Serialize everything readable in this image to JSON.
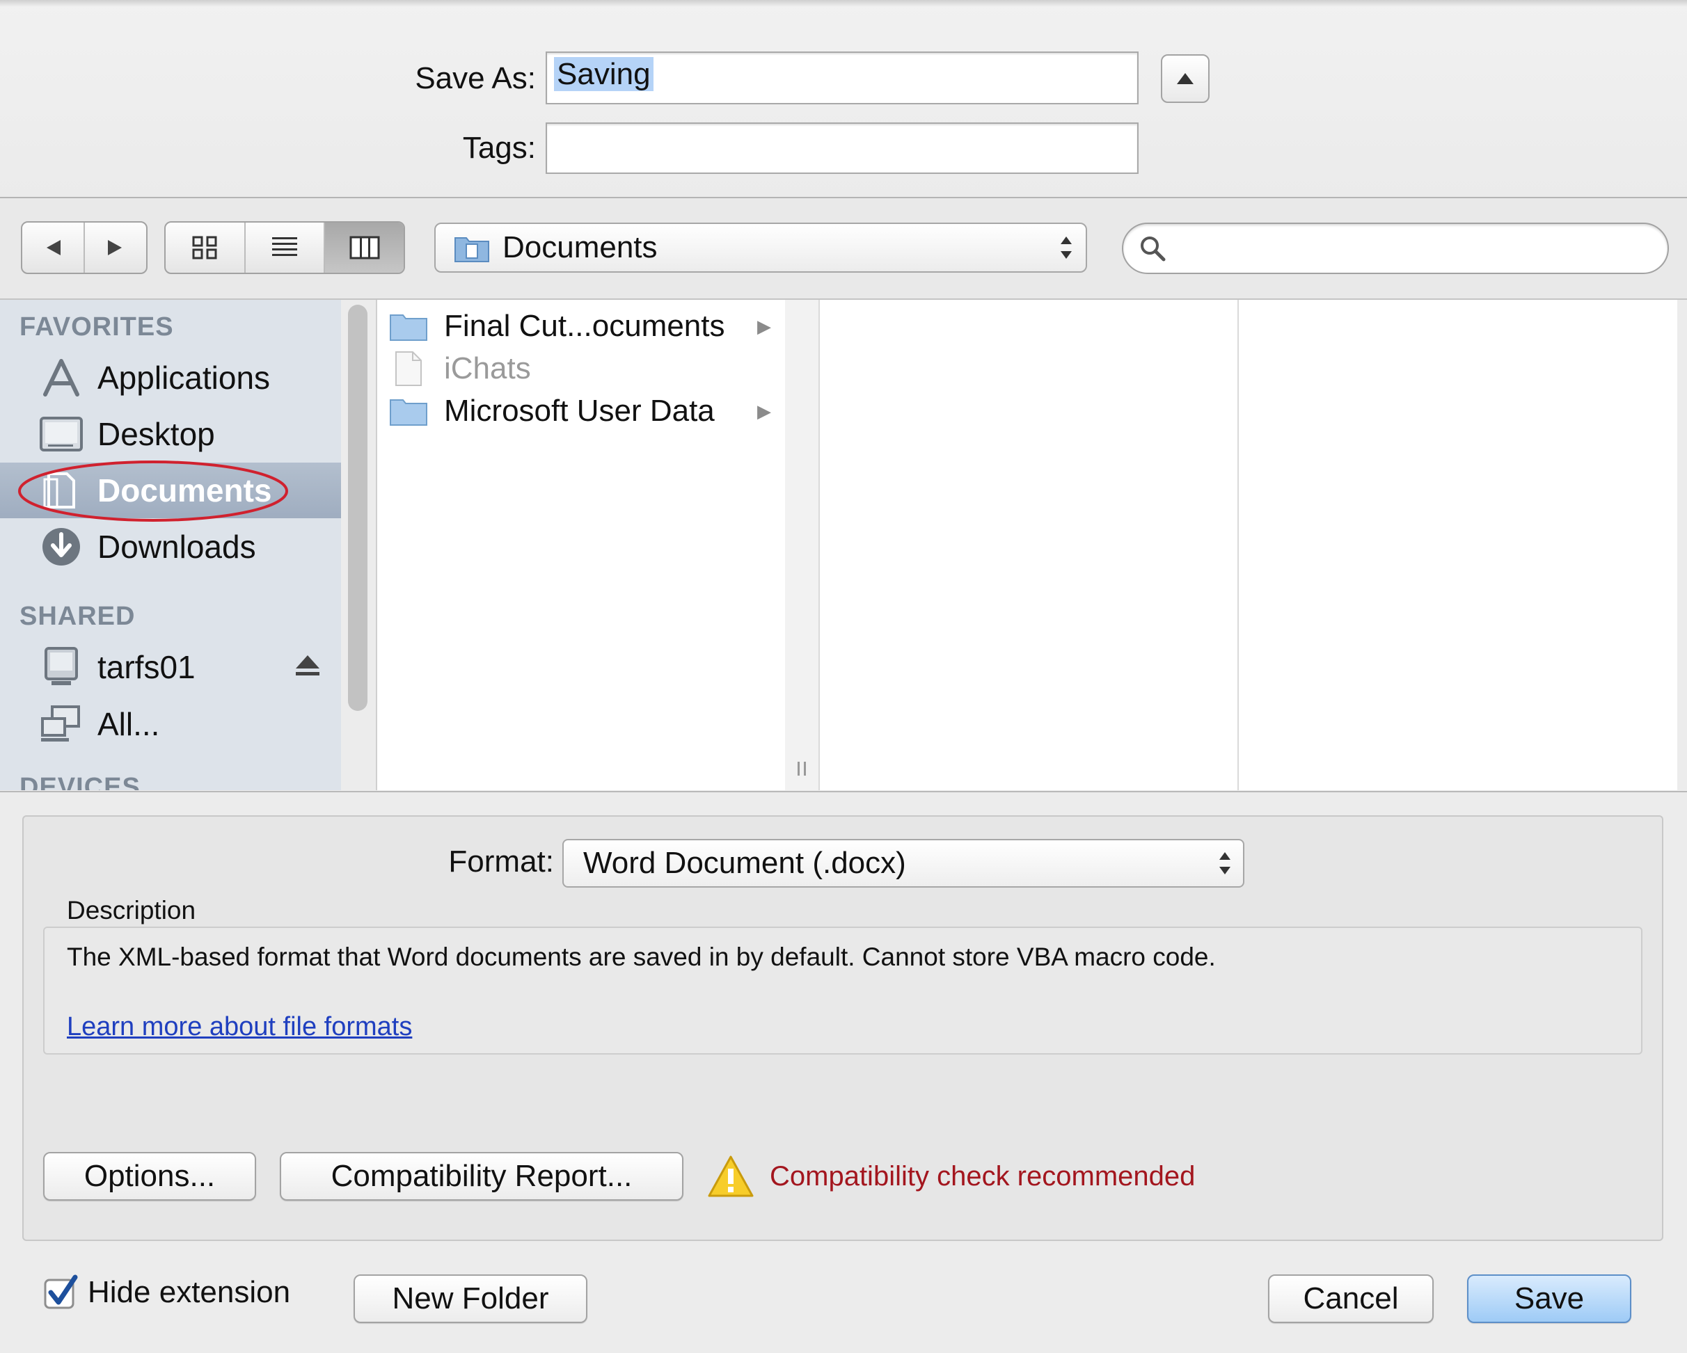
{
  "save": {
    "save_as_label": "Save As:",
    "filename": "Saving",
    "tags_label": "Tags:",
    "tags_value": ""
  },
  "toolbar": {
    "location": "Documents",
    "search_placeholder": ""
  },
  "sidebar": {
    "favorites_title": "FAVORITES",
    "favorites": [
      {
        "label": "Applications",
        "icon": "applications-icon"
      },
      {
        "label": "Desktop",
        "icon": "desktop-icon"
      },
      {
        "label": "Documents",
        "icon": "documents-icon",
        "selected": true
      },
      {
        "label": "Downloads",
        "icon": "downloads-icon"
      }
    ],
    "shared_title": "SHARED",
    "shared": [
      {
        "label": "tarfs01",
        "icon": "server-icon"
      },
      {
        "label": "All...",
        "icon": "network-icon"
      }
    ],
    "devices_title": "DEVICES"
  },
  "browser": {
    "column1": [
      {
        "label": "Final Cut...ocuments",
        "type": "folder",
        "has_children": true
      },
      {
        "label": "iChats",
        "type": "file",
        "disabled": true
      },
      {
        "label": "Microsoft User Data",
        "type": "folder",
        "has_children": true
      }
    ]
  },
  "options": {
    "format_label": "Format:",
    "format_value": "Word Document (.docx)",
    "description_label": "Description",
    "description_text": "The XML-based format that Word documents are saved in by default. Cannot store VBA macro code.",
    "learn_more": "Learn more about file formats",
    "options_button": "Options...",
    "compat_button": "Compatibility Report...",
    "warning_text": "Compatibility check recommended"
  },
  "footer": {
    "hide_extension_label": "Hide extension",
    "hide_extension_checked": true,
    "new_folder": "New Folder",
    "cancel": "Cancel",
    "save": "Save"
  },
  "colors": {
    "selection": "#b5d3f7",
    "sidebar_bg": "#dde3ea",
    "warning": "#a3161e",
    "link": "#1f3fbf",
    "annotation_circle": "#d0212e",
    "default_button": "#9ecbf6"
  }
}
